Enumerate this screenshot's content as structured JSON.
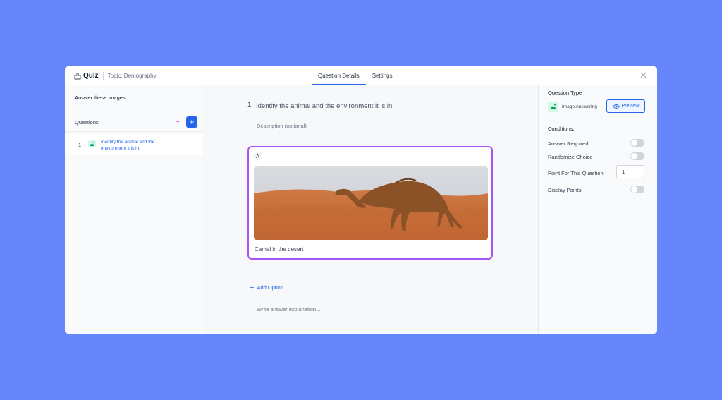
{
  "header": {
    "app_title": "Quiz",
    "topic": "Topic: Demography",
    "tabs": [
      {
        "label": "Question Details",
        "active": true
      },
      {
        "label": "Settings",
        "active": false
      }
    ]
  },
  "sidebar": {
    "title": "Answer these images",
    "questions_label": "Questions",
    "items": [
      {
        "number": "1",
        "text": "Identify the animal and the environment it is in."
      }
    ]
  },
  "main": {
    "question_number": "1.",
    "question_title": "Identify the animal and the environment it is in.",
    "description_placeholder": "Description (optional)",
    "options": [
      {
        "letter": "A",
        "caption": "Camel in the desert"
      }
    ],
    "add_option_label": "Add Option",
    "explanation_placeholder": "Write answer explanation..."
  },
  "settings": {
    "question_type_label": "Question Type",
    "question_type": "Image Answering",
    "preview_label": "Preview",
    "conditions_label": "Conditions:",
    "answer_required": "Answer Required",
    "randomize_choice": "Randomize Choice",
    "point_label": "Point For This Question",
    "point_value": "1",
    "display_points": "Display Points"
  },
  "colors": {
    "background": "#6886fc",
    "accent": "#2563eb",
    "selected_border": "#a855f7"
  }
}
